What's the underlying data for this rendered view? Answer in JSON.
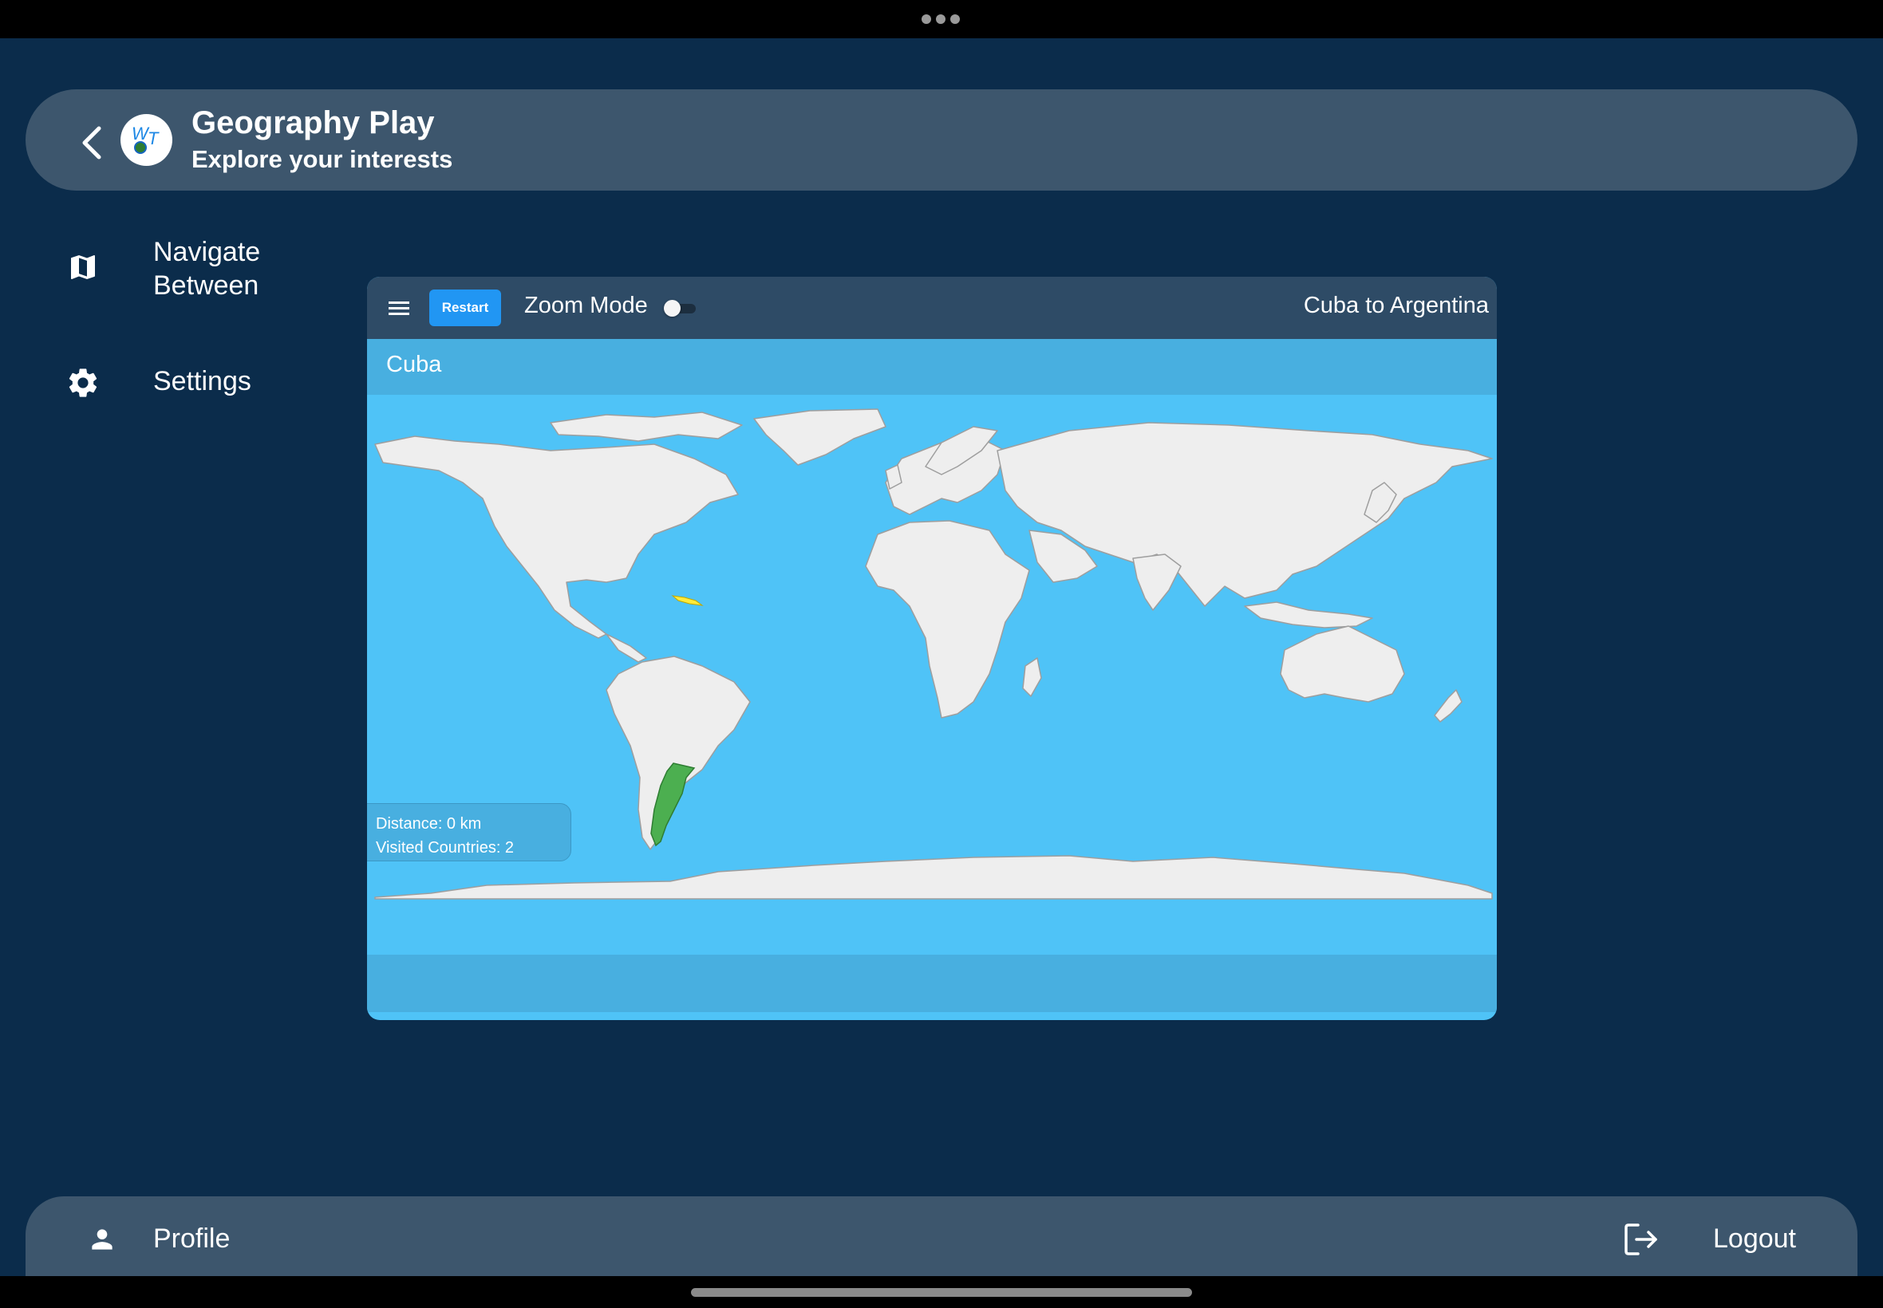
{
  "app": {
    "title": "Geography Play",
    "subtitle": "Explore your interests",
    "logo_text": "WT"
  },
  "sidebar": {
    "items": [
      {
        "label_line1": "Navigate",
        "label_line2": "Between",
        "icon": "map-icon"
      },
      {
        "label": "Settings",
        "icon": "gear-icon"
      }
    ]
  },
  "map_panel": {
    "restart_label": "Restart",
    "zoom_mode_label": "Zoom Mode",
    "zoom_mode_enabled": false,
    "route_label": "Cuba to Argentina",
    "target_country": "Cuba",
    "highlighted_countries": [
      {
        "name": "Cuba",
        "color": "#ffeb3b"
      },
      {
        "name": "Argentina",
        "color": "#4caf50"
      }
    ],
    "stats": {
      "distance": "Distance: 0 km",
      "visited": "Visited Countries: 2"
    }
  },
  "bottom_bar": {
    "profile_label": "Profile",
    "logout_label": "Logout"
  },
  "colors": {
    "background": "#0b2c4b",
    "panel": "#3d566d",
    "ocean": "#4fc3f7",
    "banner": "#48afe0",
    "land": "#eeeeee",
    "accent": "#2196f3"
  }
}
